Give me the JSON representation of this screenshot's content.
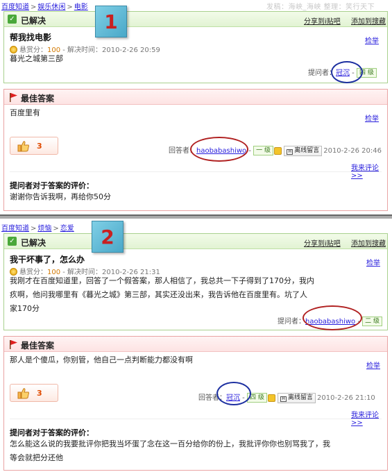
{
  "watermark": "发稿：海峡_海峡  整理：笑行天下",
  "s1": {
    "breadcrumb": [
      "百度知道",
      "娱乐休闲",
      "电影"
    ],
    "callout": "1",
    "status": "已解决",
    "share": "分享到i贴吧",
    "fav": "添加到搜藏",
    "question": "帮我找电影",
    "score_label": "悬赏分：",
    "score": "100",
    "solved_time": " - 解决时间：2010-2-26 20:59",
    "body": "暮光之城第三部",
    "report": "检举",
    "asker_label": "提问者：",
    "asker_name": "冠沉",
    "asker_level": "四 级",
    "best_title": "最佳答案",
    "answer": "百度里有",
    "answer_report": "检举",
    "likes": "3",
    "answerer_label": "回答者：",
    "answerer_name": "haobabashiwo",
    "answerer_level": "一 级",
    "offline_msg": "离线留言",
    "answer_time": "2010-2-26 20:46",
    "comment_link": "我来评论>>",
    "eval_title": "提问者对于答案的评价：",
    "eval_text": "谢谢你告诉我啊，再给你50分"
  },
  "s2": {
    "breadcrumb": [
      "百度知道",
      "烦恼",
      "恋爱"
    ],
    "callout": "2",
    "status": "已解决",
    "share": "分享到i贴吧",
    "fav": "添加到搜藏",
    "question": "我干坏事了，怎么办",
    "score_label": "悬赏分：",
    "score": "100",
    "solved_time": " - 解决时间：2010-2-26 21:31",
    "body_lines": [
      "我刚才在百度知道里，回答了一个假答案，那人相信了，我总共一下子得到了170分，我内",
      "疚啊，他问我哪里有《暮光之城》第三部，其实还没出来，我告诉他在百度里有。坑了人",
      "家170分"
    ],
    "report": "检举",
    "asker_label": "提问者：",
    "asker_name": "haobabashiwo",
    "asker_level": "二 级",
    "best_title": "最佳答案",
    "answer": "那人是个傻瓜，你别管，他自己一点判断能力都没有啊",
    "answer_report": "检举",
    "likes": "3",
    "answerer_label": "回答者：",
    "answerer_name": "冠沉",
    "answerer_level": "四 级",
    "offline_msg": "离线留言",
    "answer_time": "2010-2-26 21:10",
    "comment_link": "我来评论>>",
    "eval_title": "提问者对于答案的评价：",
    "eval_lines": [
      "怎么能这么说的我要批评你把我当坏蛋了念在这一百分给你的份上，我批评你你也别骂我了，我",
      "等会就把分还他"
    ]
  },
  "colors": {
    "link": "#261cdc",
    "green_border": "#a8d08d",
    "red_border": "#e9a3a3",
    "callout": "#4aa8c8",
    "callout_text": "#c82020",
    "oval_blue": "#1c2fa0",
    "oval_red": "#b02020"
  }
}
